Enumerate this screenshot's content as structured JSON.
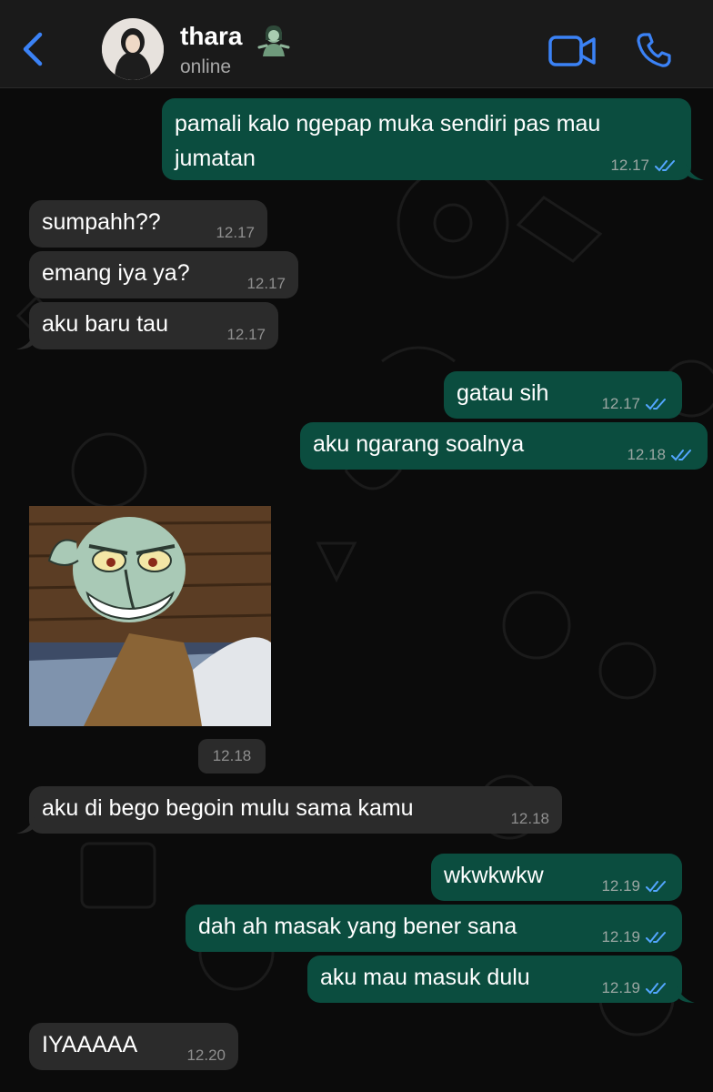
{
  "header": {
    "contact_name": "thara",
    "contact_emoji": "zombie-woman-emoji",
    "status": "online",
    "accent_color": "#3b82f6"
  },
  "messages": [
    {
      "direction": "out",
      "text": "pamali kalo ngepap muka sendiri pas mau jumatan",
      "time": "12.17",
      "status": "read"
    },
    {
      "direction": "in",
      "text": "sumpahh??",
      "time": "12.17"
    },
    {
      "direction": "in",
      "text": "emang iya ya?",
      "time": "12.17"
    },
    {
      "direction": "in",
      "text": "aku baru tau",
      "time": "12.17"
    },
    {
      "direction": "out",
      "text": "gatau sih",
      "time": "12.17",
      "status": "read"
    },
    {
      "direction": "out",
      "text": "aku ngarang soalnya",
      "time": "12.18",
      "status": "read"
    },
    {
      "direction": "in",
      "type": "sticker",
      "sticker": "angry-squidward-sticker",
      "time": "12.18"
    },
    {
      "direction": "in",
      "text": "aku di bego begoin mulu sama kamu",
      "time": "12.18"
    },
    {
      "direction": "out",
      "text": "wkwkwkw",
      "time": "12.19",
      "status": "read"
    },
    {
      "direction": "out",
      "text": "dah ah masak yang bener sana",
      "time": "12.19",
      "status": "read"
    },
    {
      "direction": "out",
      "text": "aku mau masuk dulu",
      "time": "12.19",
      "status": "read"
    },
    {
      "direction": "in",
      "text": "IYAAAAA",
      "time": "12.20"
    }
  ],
  "colors": {
    "outgoing_bubble": "#0b4d3f",
    "incoming_bubble": "#2b2b2b",
    "read_tick": "#53a6ff",
    "background": "#0b0b0b"
  }
}
